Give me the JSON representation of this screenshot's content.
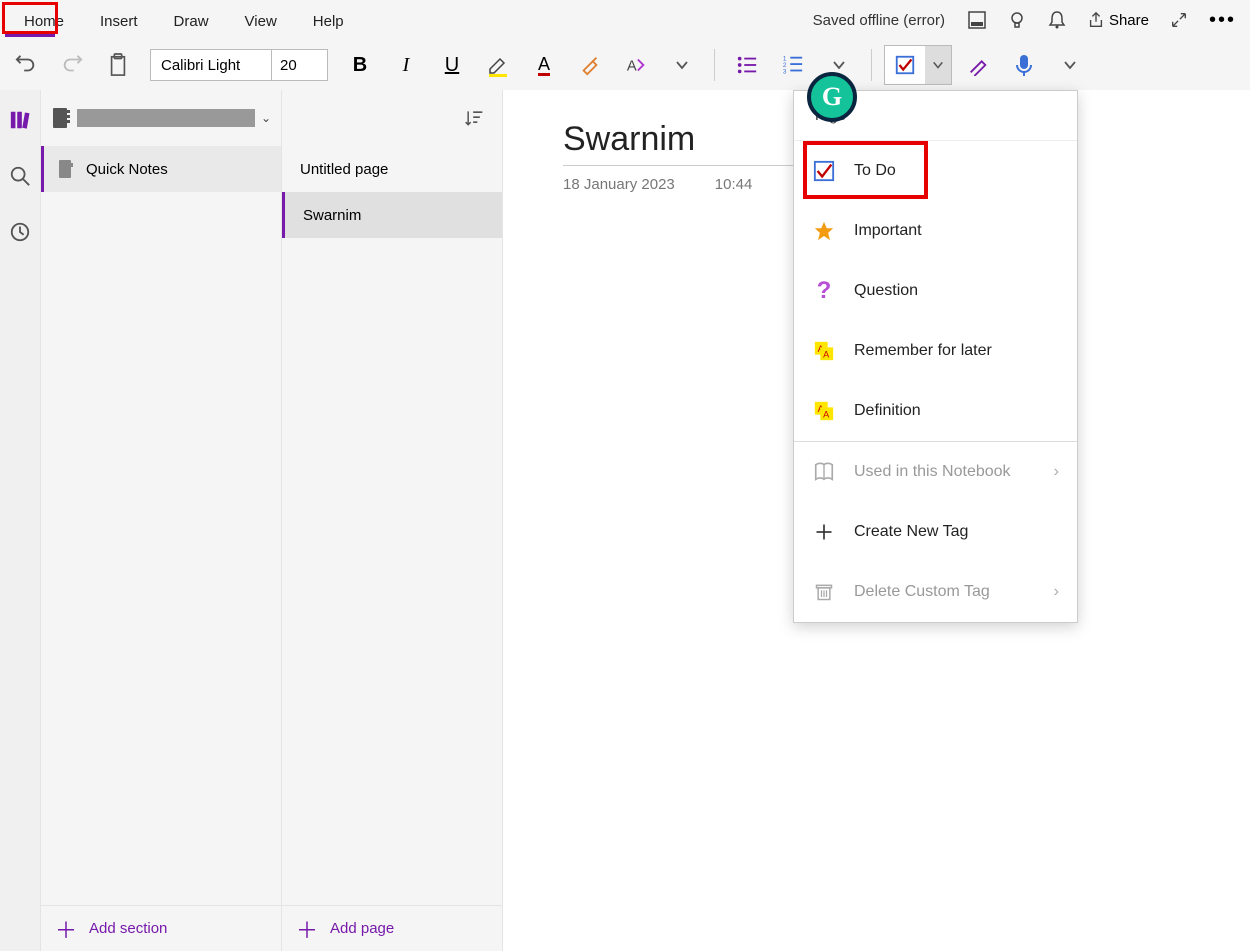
{
  "menu": {
    "home": "Home",
    "insert": "Insert",
    "draw": "Draw",
    "view": "View",
    "help": "Help"
  },
  "status": "Saved offline (error)",
  "share_label": "Share",
  "font": {
    "name": "Calibri Light",
    "size": "20"
  },
  "sections": {
    "item1": "Quick Notes",
    "add": "Add section"
  },
  "pages": {
    "item1": "Untitled page",
    "item2": "Swarnim",
    "add": "Add page"
  },
  "note": {
    "title": "Swarnim",
    "date": "18 January 2023",
    "time": "10:44"
  },
  "tags": {
    "header": "Tags",
    "todo": "To Do",
    "important": "Important",
    "question": "Question",
    "remember": "Remember for later",
    "definition": "Definition",
    "used": "Used in this Notebook",
    "create": "Create New Tag",
    "delete": "Delete Custom Tag"
  }
}
